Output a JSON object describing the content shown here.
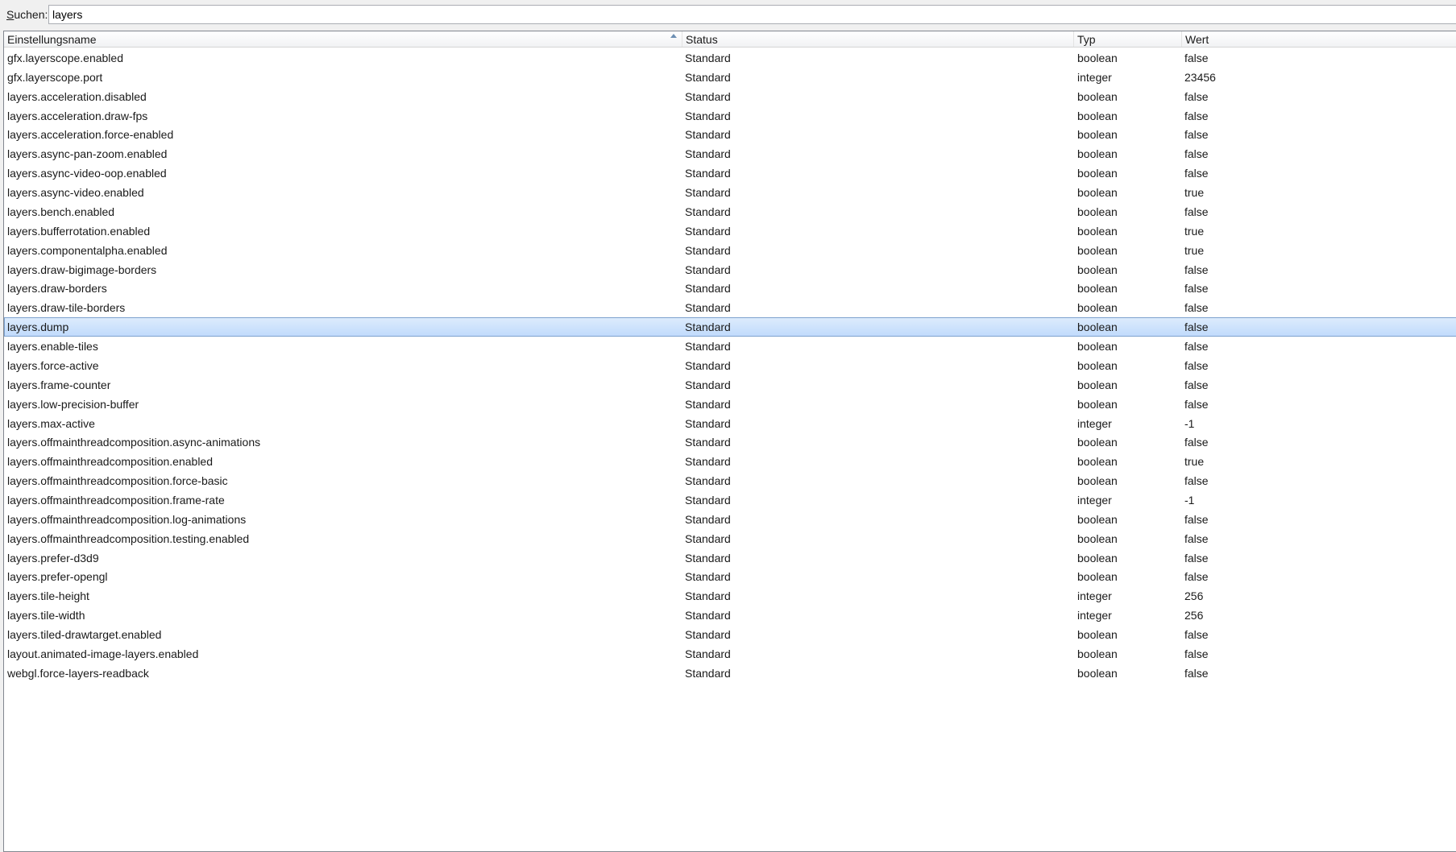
{
  "search": {
    "label": "Suchen:",
    "value": "layers"
  },
  "columns": {
    "name": "Einstellungsname",
    "status": "Status",
    "type": "Typ",
    "value": "Wert"
  },
  "sort": {
    "column": "name",
    "direction": "ascending",
    "icon": "sort-ascending-arrow"
  },
  "selected_index": 14,
  "colors": {
    "selection": "#c9e0fc",
    "selection_border": "#7da2ce"
  },
  "rows": [
    {
      "name": "gfx.layerscope.enabled",
      "status": "Standard",
      "type": "boolean",
      "value": "false"
    },
    {
      "name": "gfx.layerscope.port",
      "status": "Standard",
      "type": "integer",
      "value": "23456"
    },
    {
      "name": "layers.acceleration.disabled",
      "status": "Standard",
      "type": "boolean",
      "value": "false"
    },
    {
      "name": "layers.acceleration.draw-fps",
      "status": "Standard",
      "type": "boolean",
      "value": "false"
    },
    {
      "name": "layers.acceleration.force-enabled",
      "status": "Standard",
      "type": "boolean",
      "value": "false"
    },
    {
      "name": "layers.async-pan-zoom.enabled",
      "status": "Standard",
      "type": "boolean",
      "value": "false"
    },
    {
      "name": "layers.async-video-oop.enabled",
      "status": "Standard",
      "type": "boolean",
      "value": "false"
    },
    {
      "name": "layers.async-video.enabled",
      "status": "Standard",
      "type": "boolean",
      "value": "true"
    },
    {
      "name": "layers.bench.enabled",
      "status": "Standard",
      "type": "boolean",
      "value": "false"
    },
    {
      "name": "layers.bufferrotation.enabled",
      "status": "Standard",
      "type": "boolean",
      "value": "true"
    },
    {
      "name": "layers.componentalpha.enabled",
      "status": "Standard",
      "type": "boolean",
      "value": "true"
    },
    {
      "name": "layers.draw-bigimage-borders",
      "status": "Standard",
      "type": "boolean",
      "value": "false"
    },
    {
      "name": "layers.draw-borders",
      "status": "Standard",
      "type": "boolean",
      "value": "false"
    },
    {
      "name": "layers.draw-tile-borders",
      "status": "Standard",
      "type": "boolean",
      "value": "false"
    },
    {
      "name": "layers.dump",
      "status": "Standard",
      "type": "boolean",
      "value": "false"
    },
    {
      "name": "layers.enable-tiles",
      "status": "Standard",
      "type": "boolean",
      "value": "false"
    },
    {
      "name": "layers.force-active",
      "status": "Standard",
      "type": "boolean",
      "value": "false"
    },
    {
      "name": "layers.frame-counter",
      "status": "Standard",
      "type": "boolean",
      "value": "false"
    },
    {
      "name": "layers.low-precision-buffer",
      "status": "Standard",
      "type": "boolean",
      "value": "false"
    },
    {
      "name": "layers.max-active",
      "status": "Standard",
      "type": "integer",
      "value": "-1"
    },
    {
      "name": "layers.offmainthreadcomposition.async-animations",
      "status": "Standard",
      "type": "boolean",
      "value": "false"
    },
    {
      "name": "layers.offmainthreadcomposition.enabled",
      "status": "Standard",
      "type": "boolean",
      "value": "true"
    },
    {
      "name": "layers.offmainthreadcomposition.force-basic",
      "status": "Standard",
      "type": "boolean",
      "value": "false"
    },
    {
      "name": "layers.offmainthreadcomposition.frame-rate",
      "status": "Standard",
      "type": "integer",
      "value": "-1"
    },
    {
      "name": "layers.offmainthreadcomposition.log-animations",
      "status": "Standard",
      "type": "boolean",
      "value": "false"
    },
    {
      "name": "layers.offmainthreadcomposition.testing.enabled",
      "status": "Standard",
      "type": "boolean",
      "value": "false"
    },
    {
      "name": "layers.prefer-d3d9",
      "status": "Standard",
      "type": "boolean",
      "value": "false"
    },
    {
      "name": "layers.prefer-opengl",
      "status": "Standard",
      "type": "boolean",
      "value": "false"
    },
    {
      "name": "layers.tile-height",
      "status": "Standard",
      "type": "integer",
      "value": "256"
    },
    {
      "name": "layers.tile-width",
      "status": "Standard",
      "type": "integer",
      "value": "256"
    },
    {
      "name": "layers.tiled-drawtarget.enabled",
      "status": "Standard",
      "type": "boolean",
      "value": "false"
    },
    {
      "name": "layout.animated-image-layers.enabled",
      "status": "Standard",
      "type": "boolean",
      "value": "false"
    },
    {
      "name": "webgl.force-layers-readback",
      "status": "Standard",
      "type": "boolean",
      "value": "false"
    }
  ]
}
